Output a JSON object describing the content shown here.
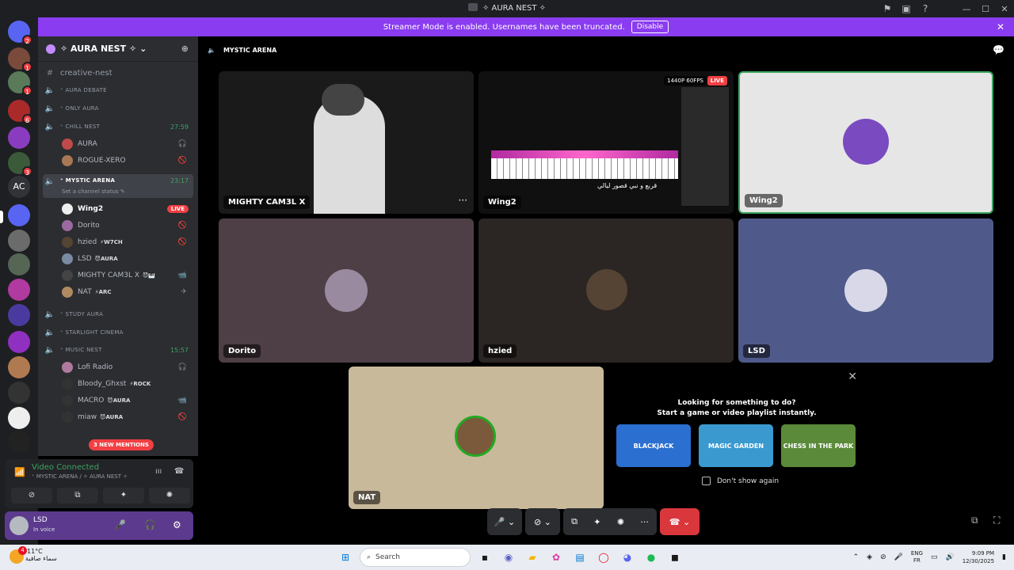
{
  "window": {
    "title": "✧ AURA NEST ✧",
    "minimize": "—",
    "maximize": "☐",
    "close": "✕"
  },
  "banner": {
    "text": "Streamer Mode is enabled. Usernames have been truncated.",
    "button": "Disable",
    "close": "✕"
  },
  "servers": [
    {
      "badge": "2"
    },
    {
      "badge": "1"
    },
    {
      "badge": "1"
    },
    {
      "badge": "6"
    },
    {
      "badge": ""
    },
    {
      "badge": "3"
    }
  ],
  "server_ac": "AC",
  "guild": {
    "name": "✧ AURA NEST ✧",
    "chevron": "⌄"
  },
  "channels": [
    {
      "icon": "#",
      "name": "creative-nest",
      "kind": "text",
      "small": false
    },
    {
      "icon": "🔈",
      "name": "⁺ AURA DEBATE",
      "kind": "voice",
      "small": true
    },
    {
      "icon": "🔈",
      "name": "⁺ ONLY AURA",
      "kind": "voice",
      "small": true
    },
    {
      "icon": "🔈",
      "name": "⁺ CHILL NEST",
      "kind": "voice",
      "small": true,
      "time": "27:59"
    }
  ],
  "chill_users": [
    {
      "name": "AURA",
      "tag": "",
      "right": "🎧"
    },
    {
      "name": "ROGUE-XERO",
      "tag": "",
      "right": "🚫"
    }
  ],
  "active_channel": {
    "name": "⁺ MYSTIC ARENA",
    "time": "23:17",
    "status": "Set a channel status ✎"
  },
  "arena_users": [
    {
      "name": "Wing2",
      "tag": "",
      "right": "LIVE"
    },
    {
      "name": "Dorito",
      "tag": "",
      "right": "🚫"
    },
    {
      "name": "hzied",
      "tag": "⚡W7CH",
      "right": "🚫"
    },
    {
      "name": "LSD",
      "tag": "😈AURA",
      "right": ""
    },
    {
      "name": "MIGHTY CAM3L X",
      "tag": "😈🎹",
      "right": "📹"
    },
    {
      "name": "NAT",
      "tag": "⚡ARC",
      "right": "✈"
    }
  ],
  "channels2": [
    {
      "icon": "🔈",
      "name": "⁺ STUDY AURA"
    },
    {
      "icon": "🔈",
      "name": "⁺ STARLIGHT CINEMA"
    },
    {
      "icon": "🔈",
      "name": "⁺ MUSIC NEST",
      "time": "15:57"
    }
  ],
  "music_users": [
    {
      "name": "Lofi Radio",
      "tag": "",
      "right": "🎧"
    },
    {
      "name": "Bloody_Ghxst",
      "tag": "⚡ROCK",
      "right": ""
    },
    {
      "name": "MACRO",
      "tag": "😈AURA",
      "right": "📹"
    },
    {
      "name": "miaw",
      "tag": "😈AURA",
      "right": "🚫"
    }
  ],
  "new_mentions": "3 NEW MENTIONS",
  "voice": {
    "status": "Video Connected",
    "location": "⁺ MYSTIC ARENA / ✧ AURA NEST ✧"
  },
  "me": {
    "name": "LSD",
    "status": "In voice"
  },
  "stage": {
    "channel": "MYSTIC ARENA"
  },
  "tiles": [
    {
      "label": "MIGHTY CAM3L X",
      "more": "···"
    },
    {
      "label": "Wing2",
      "quality": "1440P 60FPS",
      "live": "LIVE",
      "caption": "قربع و نبي قصور ليالي"
    },
    {
      "label": "Wing2"
    },
    {
      "label": "Dorito"
    },
    {
      "label": "hzied"
    },
    {
      "label": "LSD"
    },
    {
      "label": "NAT"
    }
  ],
  "activity": {
    "line1": "Looking for something to do?",
    "line2": "Start a game or video playlist instantly.",
    "games": [
      "BLACKJACK",
      "MAGIC GARDEN",
      "CHESS IN THE PARK"
    ],
    "dont_show": "Don't show again"
  },
  "taskbar": {
    "temp": "11°C",
    "weather": "سماء صافية",
    "weather_badge": "4",
    "search": "Search",
    "lang1": "ENG",
    "lang2": "FR",
    "time": "9:09 PM",
    "date": "12/30/2025"
  }
}
